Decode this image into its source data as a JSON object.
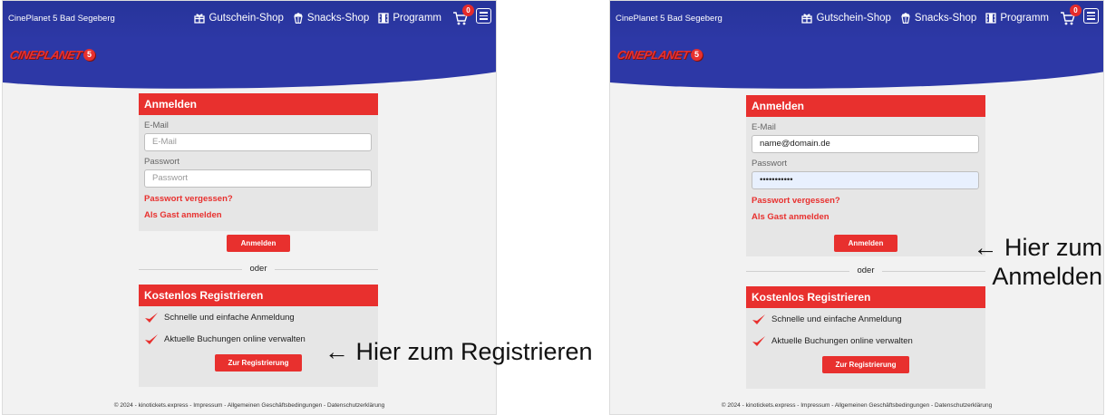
{
  "site": {
    "brand": "CinePlanet 5 Bad Segeberg",
    "logo_text": "CINEPLANET",
    "logo_number": "5",
    "nav": [
      {
        "label": "Gutschein-Shop",
        "icon": "gift-icon"
      },
      {
        "label": "Snacks-Shop",
        "icon": "popcorn-icon"
      },
      {
        "label": "Programm",
        "icon": "film-icon"
      }
    ],
    "cart_count": "0",
    "cart_icon": "shopping-cart-icon",
    "menu_icon": "hamburger-menu-icon",
    "footer": "© 2024 - kinotickets.express - Impressum - Allgemeinen Geschäftsbedingungen - Datenschutzerklärung"
  },
  "login": {
    "title": "Anmelden",
    "email_label": "E-Mail",
    "password_label": "Passwort",
    "forgot_link": "Passwort vergessen?",
    "guest_link": "Als Gast anmelden",
    "submit_label": "Anmelden"
  },
  "divider": "oder",
  "register": {
    "title": "Kostenlos Registrieren",
    "benefits": [
      "Schnelle und einfache Anmeldung",
      "Aktuelle Buchungen online verwalten"
    ],
    "button_label": "Zur Registrierung"
  },
  "screens": [
    {
      "email_value": "",
      "email_placeholder": "E-Mail",
      "password_value": "",
      "password_placeholder": "Passwort",
      "annotation": "← Hier zum Registrieren"
    },
    {
      "email_value": "name@domain.de",
      "email_placeholder": "E-Mail",
      "password_value": "•••••••••••",
      "password_placeholder": "Passwort",
      "annotation_lines": [
        "← Hier zum",
        "Anmelden"
      ]
    }
  ],
  "colors": {
    "header_blue": "#2d38a6",
    "brand_red": "#e8302e",
    "card_grey": "#e6e6e6",
    "autofill_blue": "#e8f0fe"
  }
}
